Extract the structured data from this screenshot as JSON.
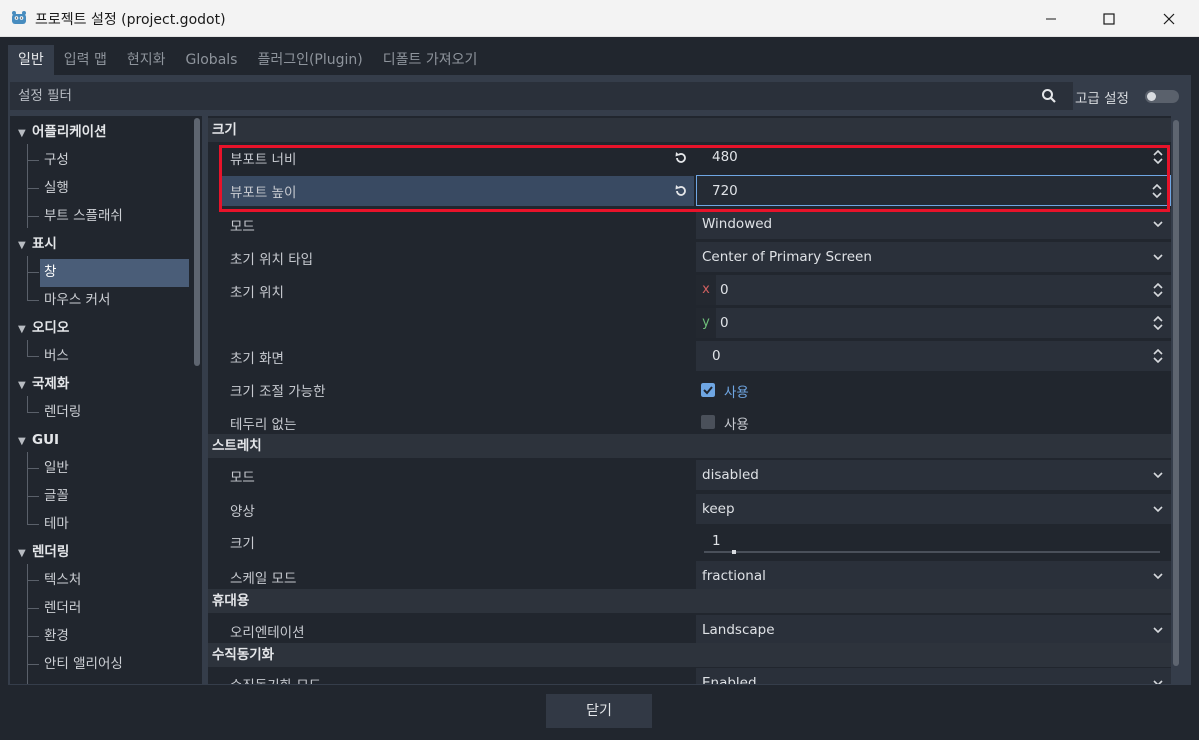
{
  "window": {
    "title": "프로젝트 설정 (project.godot)",
    "icon": "godot-icon"
  },
  "tabs": [
    "일반",
    "입력 맵",
    "현지화",
    "Globals",
    "플러그인(Plugin)",
    "디폴트 가져오기"
  ],
  "filter": {
    "placeholder": "설정 필터",
    "advanced_label": "고급 설정",
    "advanced_enabled": false
  },
  "sidebar": {
    "sections": [
      {
        "label": "어플리케이션",
        "items": [
          "구성",
          "실행",
          "부트 스플래쉬"
        ]
      },
      {
        "label": "표시",
        "items": [
          "창",
          "마우스 커서"
        ],
        "selected": "창"
      },
      {
        "label": "오디오",
        "items": [
          "버스"
        ]
      },
      {
        "label": "국제화",
        "items": [
          "렌더링"
        ]
      },
      {
        "label": "GUI",
        "items": [
          "일반",
          "글꼴",
          "테마"
        ]
      },
      {
        "label": "렌더링",
        "items": [
          "텍스처",
          "렌더러",
          "환경",
          "안티 앨리어싱"
        ]
      }
    ]
  },
  "content": {
    "size_section": "크기",
    "viewport_width": {
      "label": "뷰포트 너비",
      "value": "480"
    },
    "viewport_height": {
      "label": "뷰포트 높이",
      "value": "720"
    },
    "mode": {
      "label": "모드",
      "value": "Windowed"
    },
    "initial_position_type": {
      "label": "초기 위치 타입",
      "value": "Center of Primary Screen"
    },
    "initial_position": {
      "label": "초기 위치",
      "x_tag": "x",
      "x": "0",
      "y_tag": "y",
      "y": "0"
    },
    "initial_screen": {
      "label": "초기 화면",
      "value": "0"
    },
    "resizable": {
      "label": "크기 조절 가능한",
      "value_label": "사용",
      "checked": true
    },
    "borderless": {
      "label": "테두리 없는",
      "value_label": "사용",
      "checked": false
    },
    "stretch_section": "스트레치",
    "stretch_mode": {
      "label": "모드",
      "value": "disabled"
    },
    "stretch_aspect": {
      "label": "양상",
      "value": "keep"
    },
    "stretch_scale": {
      "label": "크기",
      "value": "1"
    },
    "stretch_scale_mode": {
      "label": "스케일 모드",
      "value": "fractional"
    },
    "handheld_section": "휴대용",
    "orientation": {
      "label": "오리엔테이션",
      "value": "Landscape"
    },
    "vsync_section": "수직동기화",
    "vsync_mode": {
      "label": "수직동기화 모드",
      "value": "Enabled"
    }
  },
  "footer": {
    "close_label": "닫기"
  },
  "colors": {
    "accent": "#6fa6e3",
    "highlight": "#e8132a",
    "selection": "#4a5d78"
  }
}
